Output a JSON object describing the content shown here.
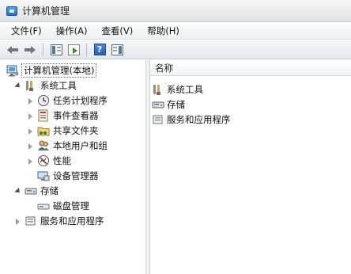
{
  "window": {
    "title": "计算机管理"
  },
  "menu": {
    "items": [
      "文件(F)",
      "操作(A)",
      "查看(V)",
      "帮助(H)"
    ]
  },
  "toolbar": {
    "buttons": [
      "back",
      "forward",
      "show-hide-console-tree",
      "export-list",
      "help",
      "show-hide-action-pane"
    ]
  },
  "tree": {
    "root": "计算机管理(本地)",
    "system_tools": "系统工具",
    "task_scheduler": "任务计划程序",
    "event_viewer": "事件查看器",
    "shared_folders": "共享文件夹",
    "local_users_groups": "本地用户和组",
    "performance": "性能",
    "device_manager": "设备管理器",
    "storage": "存储",
    "disk_management": "磁盘管理",
    "services_apps": "服务和应用程序"
  },
  "list": {
    "column_name": "名称",
    "items": [
      "系统工具",
      "存储",
      "服务和应用程序"
    ]
  }
}
